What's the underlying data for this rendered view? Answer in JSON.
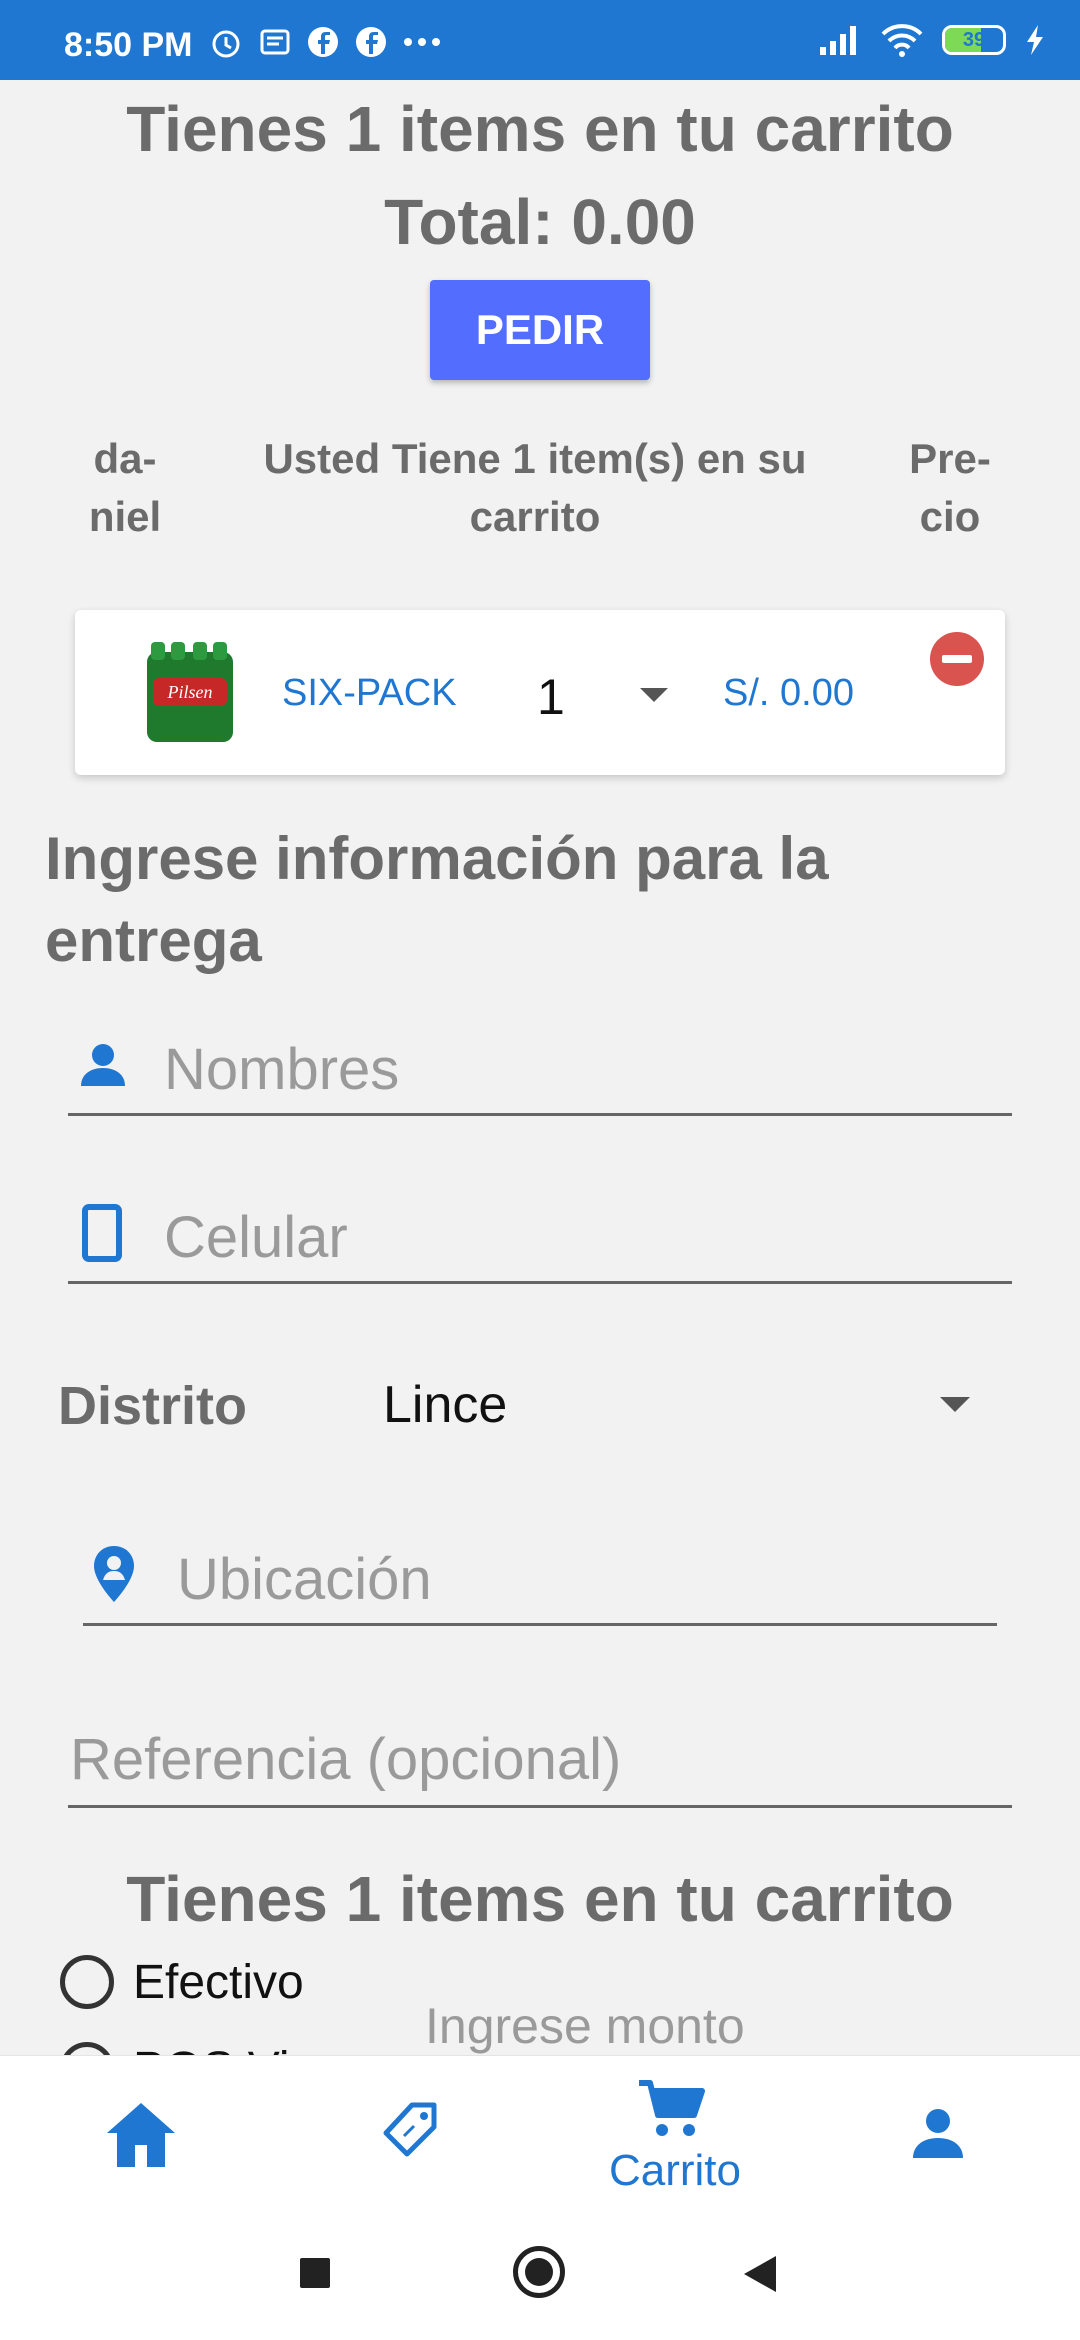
{
  "status_bar": {
    "time": "8:50 PM",
    "battery": "39"
  },
  "cart": {
    "headline": "Tienes 1 items en tu carrito",
    "total": "Total: 0.00",
    "order_button": "PEDIR",
    "columns": {
      "left": "da-\nniel",
      "middle": "Usted Tiene 1 item(s) en su carrito",
      "right": "Pre-\ncio"
    },
    "items": [
      {
        "image_label": "Pilsen",
        "name": "SIX-PACK",
        "quantity": "1",
        "price": "S/. 0.00"
      }
    ]
  },
  "delivery": {
    "section_title": "Ingrese información para la entrega",
    "name_placeholder": "Nombres",
    "phone_placeholder": "Celular",
    "district_label": "Distrito",
    "district_value": "Lince",
    "location_placeholder": "Ubicación",
    "reference_placeholder": "Referencia (opcional)",
    "repeat_headline": "Tienes 1 items en tu carrito",
    "payment_options": [
      "Efectivo",
      "POS Vi"
    ],
    "amount_placeholder": "Ingrese monto"
  },
  "bottom_nav": {
    "items": [
      {
        "icon": "home-icon",
        "label": ""
      },
      {
        "icon": "tag-icon",
        "label": ""
      },
      {
        "icon": "cart-icon",
        "label": "Carrito"
      },
      {
        "icon": "person-icon",
        "label": ""
      }
    ]
  },
  "colors": {
    "primary": "#1f77d2",
    "button": "#536dfe",
    "remove": "#d9534f"
  }
}
